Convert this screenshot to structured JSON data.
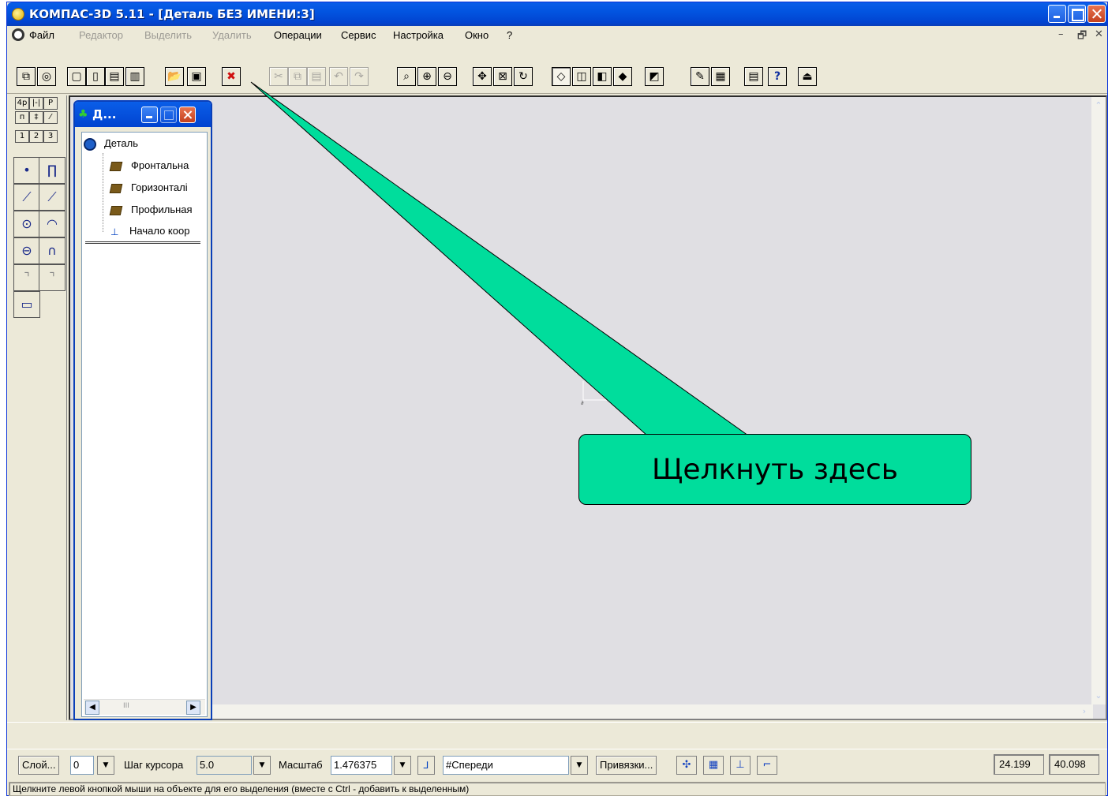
{
  "window": {
    "title": "КОМПАС-3D 5.11 - [Деталь БЕЗ ИМЕНИ:3]"
  },
  "menu": {
    "items": [
      {
        "label": "Файл",
        "disabled": false
      },
      {
        "label": "Редактор",
        "disabled": true
      },
      {
        "label": "Выделить",
        "disabled": true
      },
      {
        "label": "Удалить",
        "disabled": true
      },
      {
        "label": "Операции",
        "disabled": false
      },
      {
        "label": "Сервис",
        "disabled": false
      },
      {
        "label": "Настройка",
        "disabled": false
      },
      {
        "label": "Окно",
        "disabled": false
      },
      {
        "label": "?",
        "disabled": false
      }
    ],
    "right_controls": [
      "–",
      "🗗",
      "✕"
    ]
  },
  "toolbar": {
    "icons": [
      "new-part-icon",
      "new-assembly-icon",
      "new-drawing-icon",
      "new-fragment-icon",
      "new-text-doc-icon",
      "new-spec-icon",
      "open-icon",
      "save-icon",
      "delete-object-icon",
      "cut-icon",
      "copy-icon",
      "paste-icon",
      "undo-icon",
      "redo-icon",
      "zoom-window-icon",
      "zoom-in-icon",
      "zoom-out-icon",
      "pan-icon",
      "zoom-all-icon",
      "rotate-icon",
      "wireframe-icon",
      "hidden-lines-icon",
      "no-hidden-lines-icon",
      "shaded-icon",
      "perspective-icon",
      "properties-icon",
      "calculator-icon",
      "manager-icon",
      "help-pointer-icon",
      "exit-icon"
    ]
  },
  "vbar": {
    "top_tabs": [
      "4p",
      "|-|",
      "P",
      "п",
      "‡",
      "⁄",
      "1",
      "2",
      "3"
    ]
  },
  "tree": {
    "title": "Д...",
    "root": "Деталь",
    "items": [
      {
        "label": "Фронтальна",
        "icon": "plane-icon"
      },
      {
        "label": "Горизонталі",
        "icon": "plane-icon"
      },
      {
        "label": "Профильная",
        "icon": "plane-icon"
      },
      {
        "label": "Начало коор",
        "icon": "axis-icon"
      }
    ],
    "scroll_thumb": "III"
  },
  "callout": {
    "text": "Щелкнуть здесь",
    "fill_color": "#00dd9c"
  },
  "propbar": {
    "layer_button": "Слой...",
    "layer_value": "0",
    "step_label": "Шаг курсора",
    "step_value": "5.0",
    "scale_label": "Масштаб",
    "scale_value": "1.476375",
    "view_value": "#Спереди",
    "snaps_button": "Привязки...",
    "coord_x": "24.199",
    "coord_y": "40.098"
  },
  "status": {
    "text": "Щелкните левой кнопкой мыши на объекте для его выделения (вместе с Ctrl - добавить к выделенным)"
  }
}
